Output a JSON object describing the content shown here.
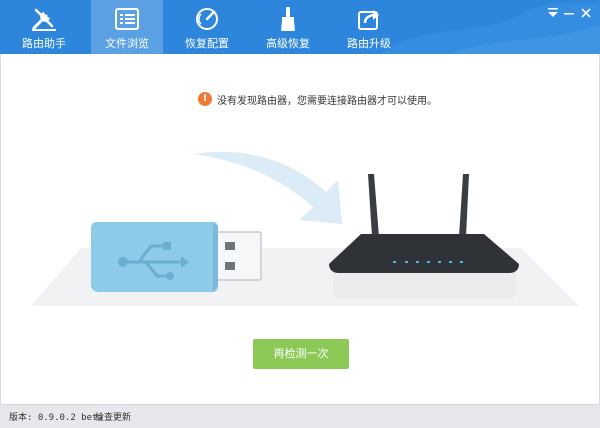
{
  "tabs": [
    {
      "label": "路由助手",
      "icon": "wrench-screwdriver-icon"
    },
    {
      "label": "文件浏览",
      "icon": "file-list-icon"
    },
    {
      "label": "恢复配置",
      "icon": "restore-gauge-icon"
    },
    {
      "label": "高级恢复",
      "icon": "brush-icon"
    },
    {
      "label": "路由升级",
      "icon": "upgrade-share-icon"
    }
  ],
  "active_tab": "文件浏览",
  "window_controls": {
    "menu_icon": "dropdown-menu-icon",
    "minimize_icon": "minimize-icon",
    "close_icon": "close-icon"
  },
  "message": {
    "icon": "warning-icon",
    "icon_glyph": "!",
    "text": "没有发现路由器，您需要连接路由器才可以使用。"
  },
  "illustration": {
    "usb_icon": "usb-drive-icon",
    "router_icon": "router-icon",
    "arrow_icon": "arrow-icon"
  },
  "retry_button": "再检测一次",
  "status": {
    "version_label": "版本: 0.9.0.2 beta",
    "update_link": "检查更新"
  },
  "colors": {
    "header": "#2d86db",
    "accent_green": "#8cc957",
    "warning": "#ef7a36",
    "usb": "#8ecbe9"
  }
}
